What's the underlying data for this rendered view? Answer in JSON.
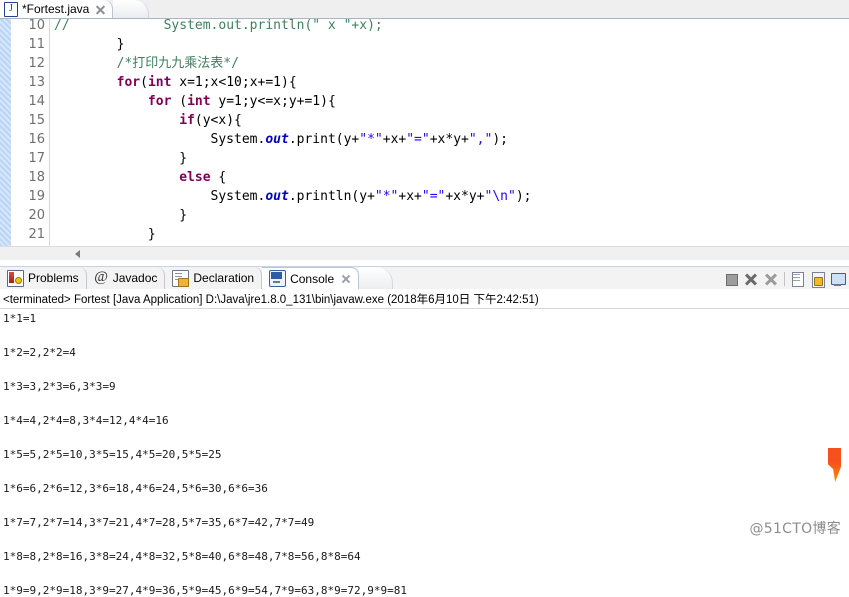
{
  "editor": {
    "tab": {
      "title": "*Fortest.java",
      "file_icon": "java-file-icon",
      "close_icon": "close-icon"
    },
    "first_visible_line": 10,
    "lines": [
      {
        "n": "10",
        "partial": true,
        "segments": [
          {
            "t": "//",
            "c": "cmt"
          },
          {
            "t": "            System.out.println(\" x \"+x);",
            "c": "cmt"
          }
        ]
      },
      {
        "n": "11",
        "segments": [
          {
            "t": "        }",
            "c": "plain"
          }
        ]
      },
      {
        "n": "12",
        "segments": [
          {
            "t": "        /*打印九九乘法表*/",
            "c": "cmt"
          }
        ]
      },
      {
        "n": "13",
        "segments": [
          {
            "t": "        ",
            "c": "plain"
          },
          {
            "t": "for",
            "c": "kw"
          },
          {
            "t": "(",
            "c": "plain"
          },
          {
            "t": "int",
            "c": "kw"
          },
          {
            "t": " x=1;x<10;x+=1){",
            "c": "plain"
          }
        ]
      },
      {
        "n": "14",
        "segments": [
          {
            "t": "            ",
            "c": "plain"
          },
          {
            "t": "for",
            "c": "kw"
          },
          {
            "t": " (",
            "c": "plain"
          },
          {
            "t": "int",
            "c": "kw"
          },
          {
            "t": " y=1;y<=x;y+=1){",
            "c": "plain"
          }
        ]
      },
      {
        "n": "15",
        "segments": [
          {
            "t": "                ",
            "c": "plain"
          },
          {
            "t": "if",
            "c": "kw"
          },
          {
            "t": "(y<x){",
            "c": "plain"
          }
        ]
      },
      {
        "n": "16",
        "segments": [
          {
            "t": "                    System.",
            "c": "plain"
          },
          {
            "t": "out",
            "c": "fld"
          },
          {
            "t": ".print(y+",
            "c": "plain"
          },
          {
            "t": "\"*\"",
            "c": "str"
          },
          {
            "t": "+x+",
            "c": "plain"
          },
          {
            "t": "\"=\"",
            "c": "str"
          },
          {
            "t": "+x*y+",
            "c": "plain"
          },
          {
            "t": "\",\"",
            "c": "str"
          },
          {
            "t": ");",
            "c": "plain"
          }
        ]
      },
      {
        "n": "17",
        "segments": [
          {
            "t": "                }",
            "c": "plain"
          }
        ]
      },
      {
        "n": "18",
        "segments": [
          {
            "t": "                ",
            "c": "plain"
          },
          {
            "t": "else",
            "c": "kw"
          },
          {
            "t": " {",
            "c": "plain"
          }
        ]
      },
      {
        "n": "19",
        "segments": [
          {
            "t": "                    System.",
            "c": "plain"
          },
          {
            "t": "out",
            "c": "fld"
          },
          {
            "t": ".println(y+",
            "c": "plain"
          },
          {
            "t": "\"*\"",
            "c": "str"
          },
          {
            "t": "+x+",
            "c": "plain"
          },
          {
            "t": "\"=\"",
            "c": "str"
          },
          {
            "t": "+x*y+",
            "c": "plain"
          },
          {
            "t": "\"\\n\"",
            "c": "str"
          },
          {
            "t": ");",
            "c": "plain"
          }
        ]
      },
      {
        "n": "20",
        "segments": [
          {
            "t": "                }",
            "c": "plain"
          }
        ]
      },
      {
        "n": "21",
        "segments": [
          {
            "t": "            }",
            "c": "plain"
          }
        ]
      }
    ],
    "hscrollbar": "editor-horizontal-scrollbar"
  },
  "view_tabs": [
    {
      "label": "Problems",
      "icon": "problems-icon",
      "selected": false,
      "closable": false
    },
    {
      "label": "Javadoc",
      "icon": "javadoc-icon",
      "selected": false,
      "closable": false
    },
    {
      "label": "Declaration",
      "icon": "declaration-icon",
      "selected": false,
      "closable": false
    },
    {
      "label": "Console",
      "icon": "console-icon",
      "selected": true,
      "closable": true
    }
  ],
  "console_toolbar": [
    {
      "name": "terminate-button",
      "icon": "stop-square-icon"
    },
    {
      "name": "remove-launch-button",
      "icon": "x-icon"
    },
    {
      "name": "remove-all-launches-button",
      "icon": "double-x-icon"
    },
    {
      "name": "clear-console-button",
      "icon": "clear-page-icon"
    },
    {
      "name": "scroll-lock-button",
      "icon": "lock-icon"
    },
    {
      "name": "display-selected-console-button",
      "icon": "display-console-icon"
    }
  ],
  "console": {
    "status": "<terminated> Fortest [Java Application] D:\\Java\\jre1.8.0_131\\bin\\javaw.exe (2018年6月10日 下午2:42:51)",
    "output": [
      "1*1=1",
      "1*2=2,2*2=4",
      "1*3=3,2*3=6,3*3=9",
      "1*4=4,2*4=8,3*4=12,4*4=16",
      "1*5=5,2*5=10,3*5=15,4*5=20,5*5=25",
      "1*6=6,2*6=12,3*6=18,4*6=24,5*6=30,6*6=36",
      "1*7=7,2*7=14,3*7=21,4*7=28,5*7=35,6*7=42,7*7=49",
      "1*8=8,2*8=16,3*8=24,4*8=32,5*8=40,6*8=48,7*8=56,8*8=64",
      "1*9=9,2*9=18,3*9=27,4*9=36,5*9=45,6*9=54,7*9=63,8*9=72,9*9=81"
    ]
  },
  "watermark": {
    "text": "@51CTO博客"
  },
  "colors": {
    "keyword": "#7f0055",
    "comment": "#3f7f5f",
    "string": "#2a00ff",
    "field": "#0000c0",
    "tab_border": "#b9c5d2",
    "accent_orange": "#f4511e"
  }
}
